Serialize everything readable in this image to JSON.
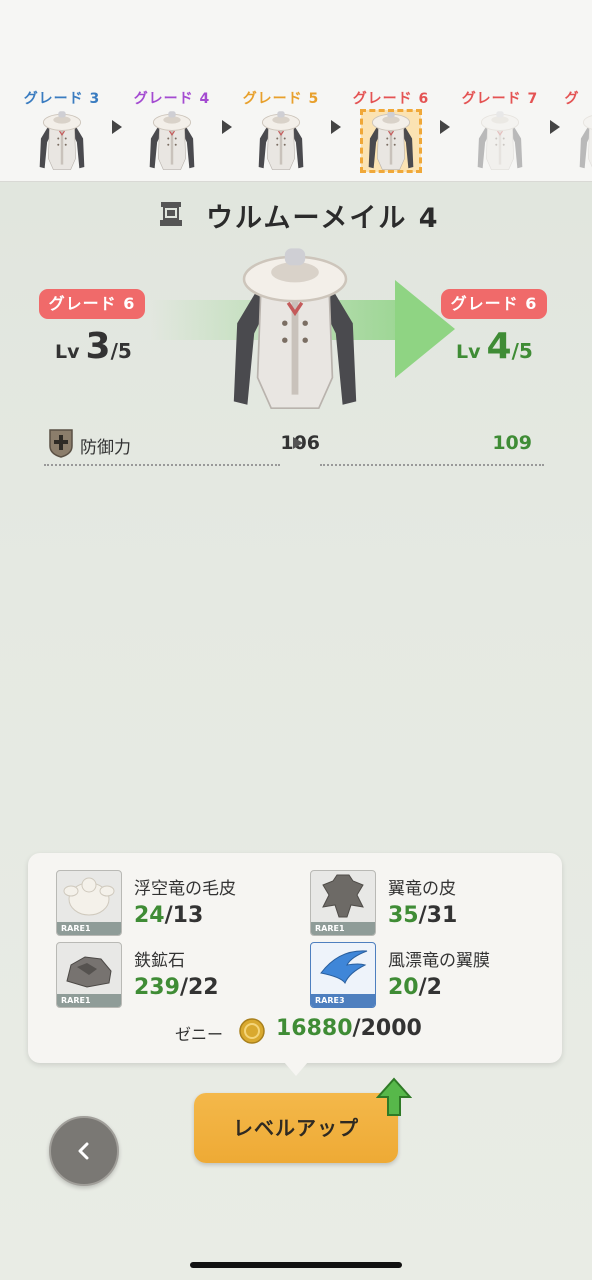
{
  "grade_strip": [
    {
      "label": "グレード 3",
      "color": "#3a7cc0",
      "state": "normal"
    },
    {
      "label": "グレード 4",
      "color": "#a44bd1",
      "state": "normal"
    },
    {
      "label": "グレード 5",
      "color": "#e8a02c",
      "state": "normal"
    },
    {
      "label": "グレード 6",
      "color": "#e45353",
      "state": "selected"
    },
    {
      "label": "グレード 7",
      "color": "#e45353",
      "state": "locked"
    },
    {
      "label": "グ",
      "color": "#e45353",
      "state": "locked"
    }
  ],
  "item": {
    "name": "ウルムーメイル 4",
    "icon": "armor-type-icon"
  },
  "current": {
    "grade_label": "グレード 6",
    "lv_prefix": "Lv",
    "level": "3",
    "max": "/5"
  },
  "next": {
    "grade_label": "グレード 6",
    "lv_prefix": "Lv",
    "level": "4",
    "max": "/5"
  },
  "stat": {
    "icon": "shield-plus-icon",
    "label": "防御力",
    "before": "106",
    "after": "109"
  },
  "materials": [
    {
      "name": "浮空竜の毛皮",
      "have": "24",
      "need": "/13",
      "rarity": "RARE1",
      "icon": "fur-icon"
    },
    {
      "name": "翼竜の皮",
      "have": "35",
      "need": "/31",
      "rarity": "RARE1",
      "icon": "hide-icon"
    },
    {
      "name": "鉄鉱石",
      "have": "239",
      "need": "/22",
      "rarity": "RARE1",
      "icon": "ore-icon"
    },
    {
      "name": "風漂竜の翼膜",
      "have": "20",
      "need": "/2",
      "rarity": "RARE3",
      "icon": "wing-membrane-icon"
    }
  ],
  "zeny": {
    "label": "ゼニー",
    "have": "16880",
    "need": "/2000",
    "icon": "coin-icon"
  },
  "buttons": {
    "level_up": "レベルアップ",
    "back_icon": "chevron-left-icon"
  },
  "colors": {
    "increase_green": "#3f8c35",
    "grade_red": "#f06a6a",
    "button_orange": "#f0ae3c"
  }
}
